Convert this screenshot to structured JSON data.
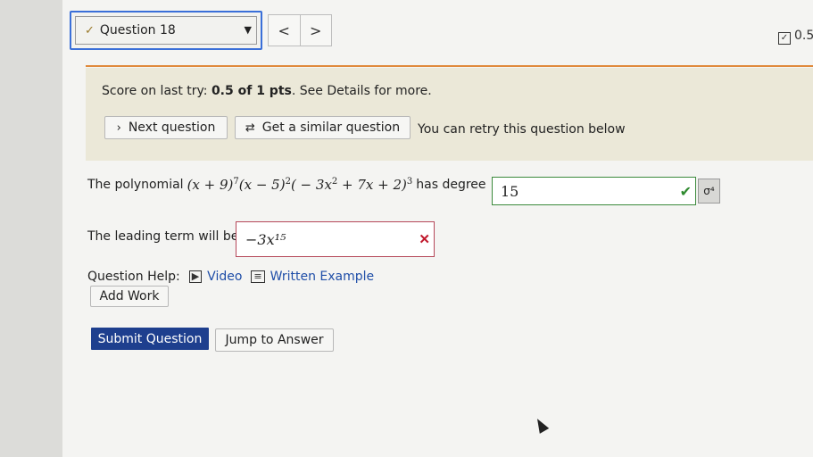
{
  "header": {
    "question_label": "Question 18",
    "prev_label": "<",
    "next_label": ">",
    "score_summary": "0.5"
  },
  "banner": {
    "score_prefix": "Score on last try: ",
    "score_value": "0.5 of 1 pts",
    "score_suffix": ". See Details for more.",
    "next_question": "Next question",
    "similar_question": "Get a similar question",
    "retry_text": "You can retry this question below"
  },
  "question": {
    "part1_prefix": "The polynomial",
    "part1_suffix": "has degree",
    "degree_answer": "15",
    "part2_prefix": "The leading term will be",
    "leading_answer": "−3x¹⁵"
  },
  "help": {
    "label": "Question Help:",
    "video": "Video",
    "written_example": "Written Example",
    "add_work": "Add Work"
  },
  "actions": {
    "submit": "Submit Question",
    "jump": "Jump to Answer"
  }
}
